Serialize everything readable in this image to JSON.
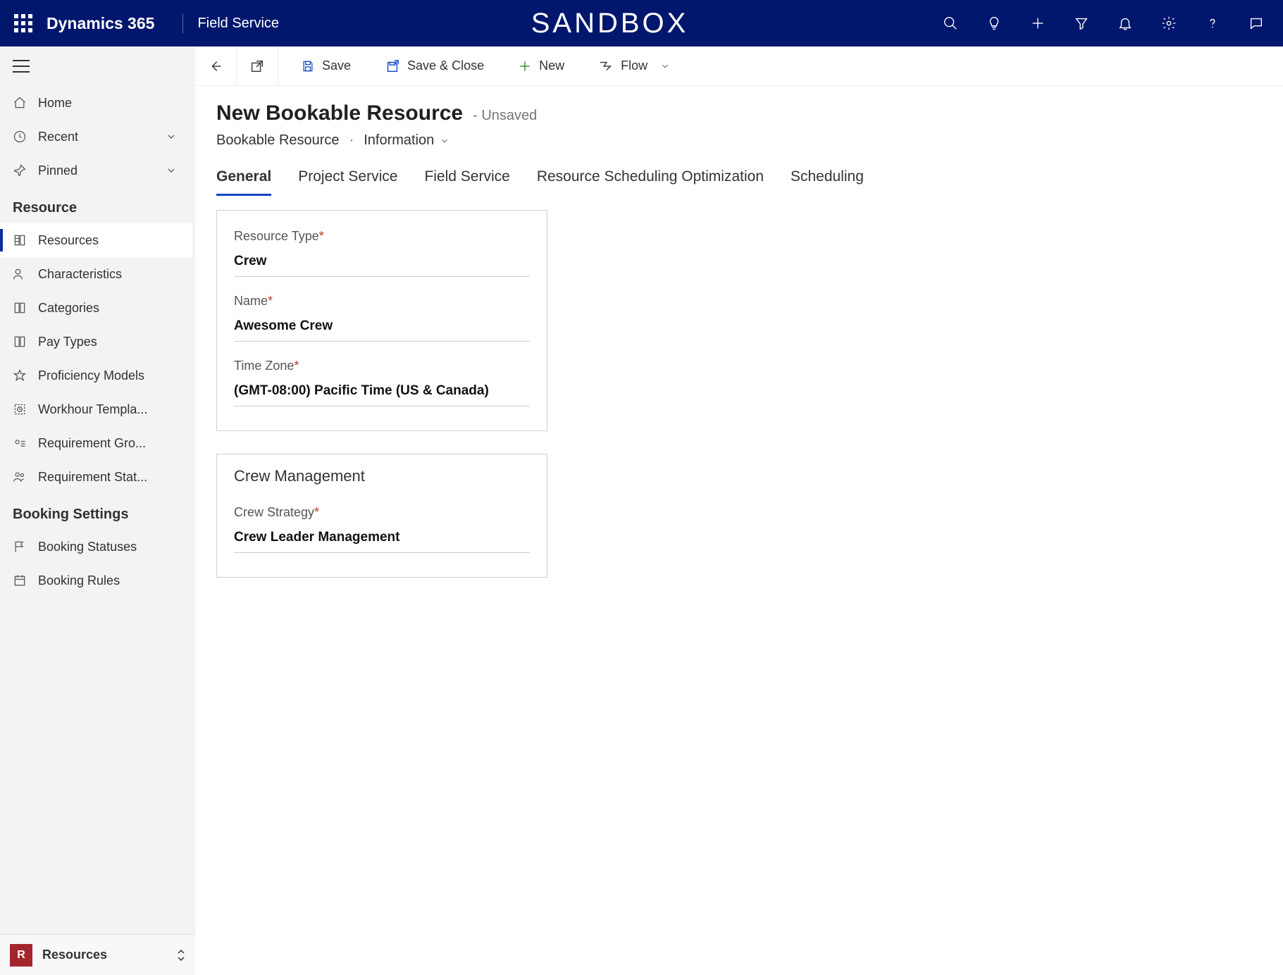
{
  "topbar": {
    "brand": "Dynamics 365",
    "area": "Field Service",
    "environment": "SANDBOX"
  },
  "sidebar": {
    "nav_home": "Home",
    "nav_recent": "Recent",
    "nav_pinned": "Pinned",
    "section_resource": "Resource",
    "items_resource": {
      "resources": "Resources",
      "characteristics": "Characteristics",
      "categories": "Categories",
      "pay_types": "Pay Types",
      "proficiency": "Proficiency Models",
      "workhour": "Workhour Templa...",
      "req_group": "Requirement Gro...",
      "req_stat": "Requirement Stat..."
    },
    "section_booking": "Booking Settings",
    "items_booking": {
      "booking_statuses": "Booking Statuses",
      "booking_rules": "Booking Rules"
    },
    "bottom": {
      "badge": "R",
      "label": "Resources"
    }
  },
  "commandbar": {
    "save": "Save",
    "save_close": "Save & Close",
    "new": "New",
    "flow": "Flow"
  },
  "page": {
    "title": "New Bookable Resource",
    "status": "- Unsaved",
    "entity": "Bookable Resource",
    "form": "Information"
  },
  "tabs": {
    "general": "General",
    "project_service": "Project Service",
    "field_service": "Field Service",
    "rso": "Resource Scheduling Optimization",
    "scheduling": "Scheduling"
  },
  "form": {
    "resource_type": {
      "label": "Resource Type",
      "value": "Crew"
    },
    "name": {
      "label": "Name",
      "value": "Awesome Crew"
    },
    "time_zone": {
      "label": "Time Zone",
      "value": "(GMT-08:00) Pacific Time (US & Canada)"
    },
    "section2_title": "Crew Management",
    "crew_strategy": {
      "label": "Crew Strategy",
      "value": "Crew Leader Management"
    }
  }
}
